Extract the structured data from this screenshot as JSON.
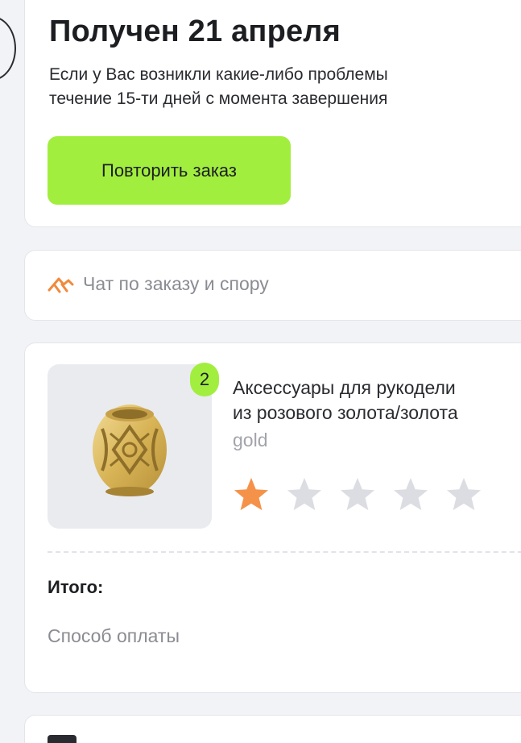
{
  "status": {
    "title": "Получен 21 апреля",
    "text_line1": "Если у Вас возникли какие-либо проблемы",
    "text_line2": "течение 15-ти дней с момента завершения",
    "repeat_button": "Повторить заказ"
  },
  "chat": {
    "label": "Чат по заказу и спору",
    "icon": "chat-dispute-icon",
    "icon_color": "#f08a3c"
  },
  "order": {
    "product": {
      "quantity": "2",
      "title_line1": "Аксессуары для рукодели",
      "title_line2": "из розового золота/золота",
      "variant": "gold",
      "rating": 1,
      "rating_max": 5
    },
    "total_label": "Итого:",
    "payment_label": "Способ оплаты"
  },
  "colors": {
    "accent_green": "#a2ee3f",
    "star_filled": "#f5924a",
    "star_empty": "#dcdde2",
    "muted_text": "#8b8c93"
  }
}
